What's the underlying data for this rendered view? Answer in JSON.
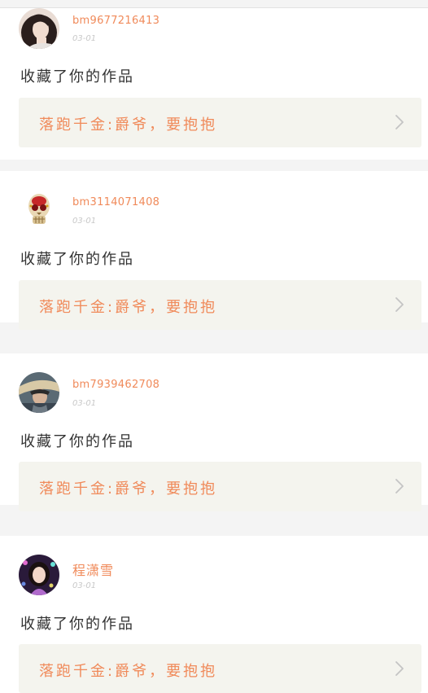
{
  "notifications": [
    {
      "username": "bm9677216413",
      "date": "03-01",
      "action": "收藏了你的作品",
      "work_title": "落跑千金:爵爷，要抱抱",
      "avatar_icon": "girl-portrait-icon"
    },
    {
      "username": "bm3114071408",
      "date": "03-01",
      "action": "收藏了你的作品",
      "work_title": "落跑千金:爵爷，要抱抱",
      "avatar_icon": "jeweled-skull-icon"
    },
    {
      "username": "bm7939462708",
      "date": "03-01",
      "action": "收藏了你的作品",
      "work_title": "落跑千金:爵爷，要抱抱",
      "avatar_icon": "hat-warrior-icon"
    },
    {
      "username": "程潇雪",
      "date": "03-01",
      "action": "收藏了你的作品",
      "work_title": "落跑千金:爵爷，要抱抱",
      "avatar_icon": "woman-portrait-icon"
    }
  ],
  "colors": {
    "accent": "#f08a5a",
    "card_bg": "#ffffff",
    "page_bg": "#f4f4f4",
    "link_bg": "#f4f4ee",
    "date_text": "#c8c8c8",
    "body_text": "#333333"
  }
}
